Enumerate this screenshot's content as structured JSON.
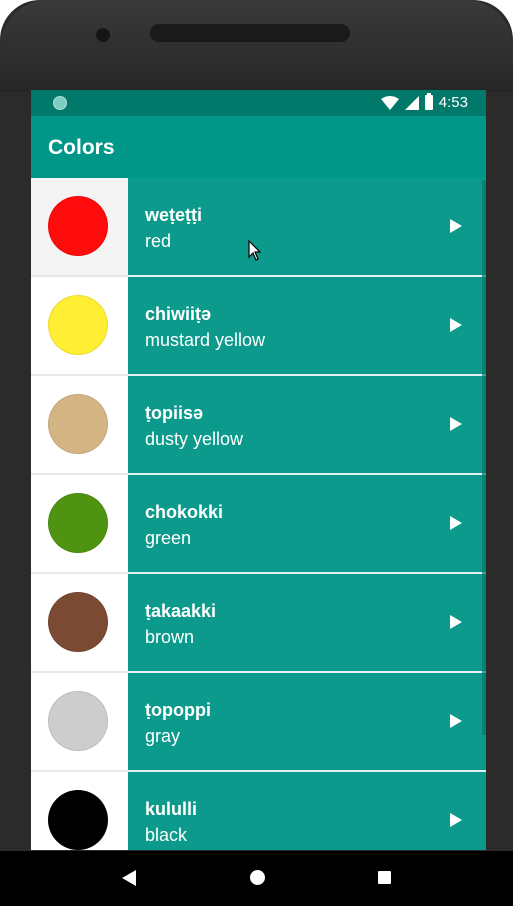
{
  "status_bar": {
    "time": "4:53",
    "icons": [
      "notification-dot-icon",
      "wifi-icon",
      "signal-icon",
      "battery-icon"
    ]
  },
  "app_bar": {
    "title": "Colors"
  },
  "list": [
    {
      "word": "weṭeṭṭi",
      "meaning": "red",
      "color": "#ff0b0b"
    },
    {
      "word": "chiwiiṭə",
      "meaning": "mustard yellow",
      "color": "#ffee33"
    },
    {
      "word": "ṭopiisə",
      "meaning": "dusty yellow",
      "color": "#d4b483"
    },
    {
      "word": "chokokki",
      "meaning": "green",
      "color": "#4e9410"
    },
    {
      "word": "ṭakaakki",
      "meaning": "brown",
      "color": "#7b4a32"
    },
    {
      "word": "ṭopoppi",
      "meaning": "gray",
      "color": "#cdcdcd"
    },
    {
      "word": "kululli",
      "meaning": "black",
      "color": "#000000"
    }
  ],
  "theme": {
    "primary": "#009688",
    "primary_dark": "#00796b",
    "list_item": "#0b9a8b"
  },
  "nav_bar": {
    "icons": [
      "back-icon",
      "home-icon",
      "recents-icon"
    ]
  }
}
